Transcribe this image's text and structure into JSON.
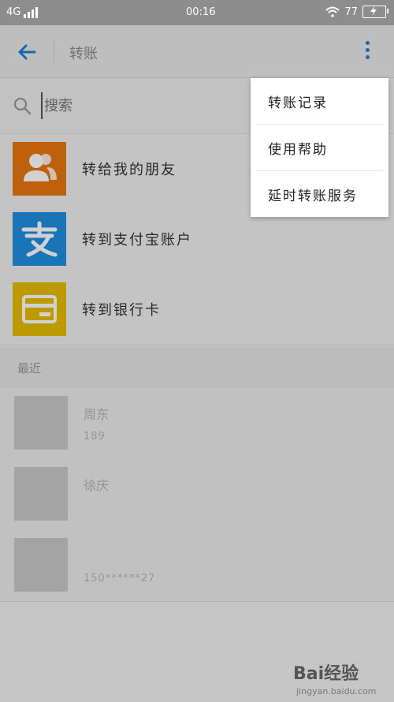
{
  "status_bar": {
    "network": "4G",
    "time": "00:16",
    "battery": "77"
  },
  "header": {
    "title": "转账"
  },
  "search": {
    "placeholder": "搜索"
  },
  "options": [
    {
      "label": "转给我的朋友",
      "icon": "contacts-icon",
      "color": "#e8760f"
    },
    {
      "label": "转到支付宝账户",
      "icon": "alipay-icon",
      "color": "#1f8fe0"
    },
    {
      "label": "转到银行卡",
      "icon": "bank-card-icon",
      "color": "#e6bc00"
    }
  ],
  "recent": {
    "header": "最近",
    "contacts": [
      {
        "name": "周东",
        "phone": "189"
      },
      {
        "name": "徐庆",
        "phone": ""
      },
      {
        "name": "",
        "phone": "150******27"
      }
    ]
  },
  "menu": {
    "items": [
      "转账记录",
      "使用帮助",
      "延时转账服务"
    ]
  },
  "watermark": {
    "logo": "Bai经验",
    "url": "jingyan.baidu.com"
  },
  "colors": {
    "accent": "#1c7fd6"
  }
}
